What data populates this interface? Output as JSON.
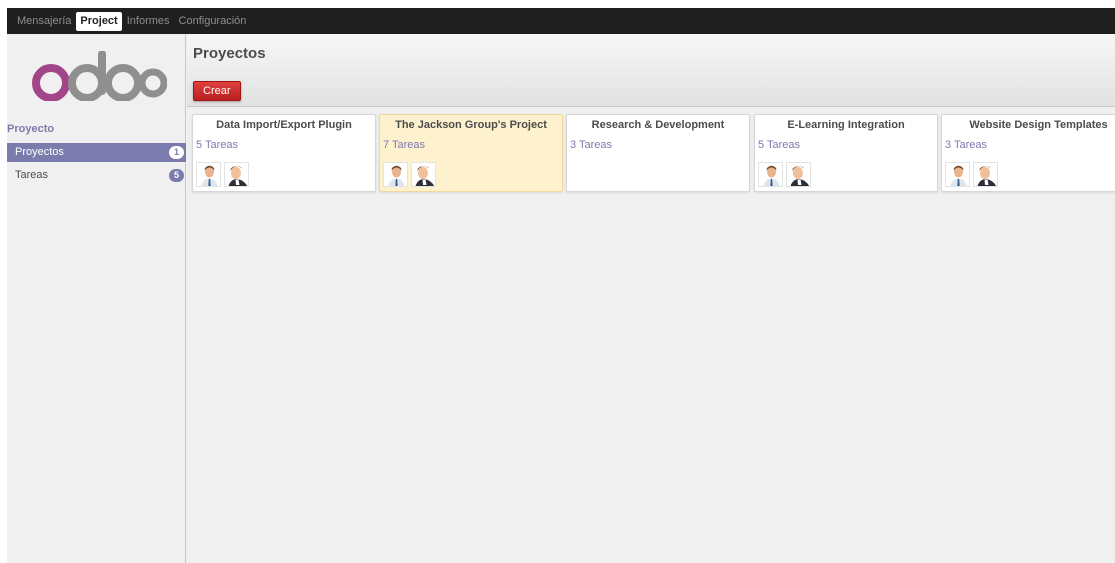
{
  "topbar": {
    "items": [
      {
        "label": "Mensajería",
        "active": false
      },
      {
        "label": "Project",
        "active": true
      },
      {
        "label": "Informes",
        "active": false
      },
      {
        "label": "Configuración",
        "active": false
      }
    ]
  },
  "sidebar": {
    "logo_text": "odoo",
    "section_title": "Proyecto",
    "items": [
      {
        "label": "Proyectos",
        "count": "1",
        "active": true
      },
      {
        "label": "Tareas",
        "count": "5",
        "active": false
      }
    ]
  },
  "header": {
    "title": "Proyectos",
    "create_label": "Crear"
  },
  "projects": [
    {
      "name": "Data Import/Export Plugin",
      "tasks": "5 Tareas",
      "members": 2,
      "highlight": false
    },
    {
      "name": "The Jackson Group's Project",
      "tasks": "7 Tareas",
      "members": 2,
      "highlight": true
    },
    {
      "name": "Research & Development",
      "tasks": "3 Tareas",
      "members": 0,
      "highlight": false
    },
    {
      "name": "E-Learning Integration",
      "tasks": "5 Tareas",
      "members": 2,
      "highlight": false
    },
    {
      "name": "Website Design Templates",
      "tasks": "3 Tareas",
      "members": 2,
      "highlight": false
    }
  ],
  "colors": {
    "accent": "#7c7bad",
    "create_button": "#c12828",
    "highlight_card": "#fdf1ce",
    "topbar": "#1f1f1f"
  }
}
